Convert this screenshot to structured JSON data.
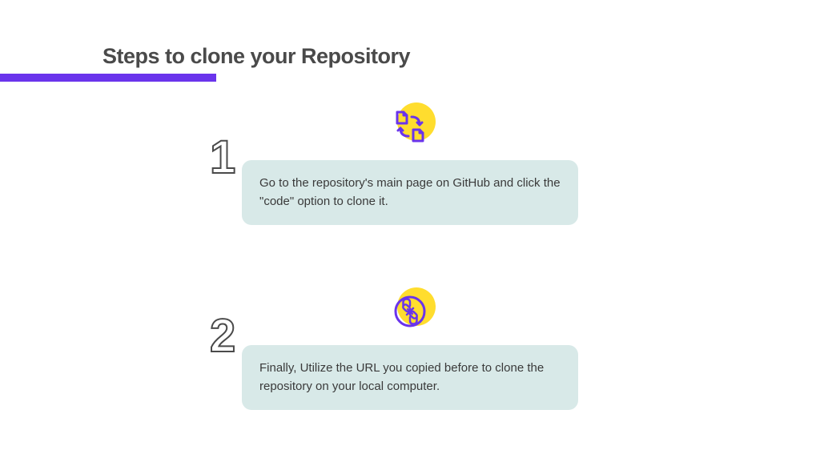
{
  "title": "Steps to clone your Repository",
  "steps": [
    {
      "number": "1",
      "text": "Go to the repository's main page on GitHub and click the \"code\" option to clone it."
    },
    {
      "number": "2",
      "text": "Finally, Utilize the URL you copied before to clone the repository on your local computer."
    }
  ],
  "colors": {
    "accent_purple": "#6a34ec",
    "accent_yellow": "#ffdd2e",
    "box_background": "#d8e9e8",
    "text_dark": "#4a4a4a"
  }
}
